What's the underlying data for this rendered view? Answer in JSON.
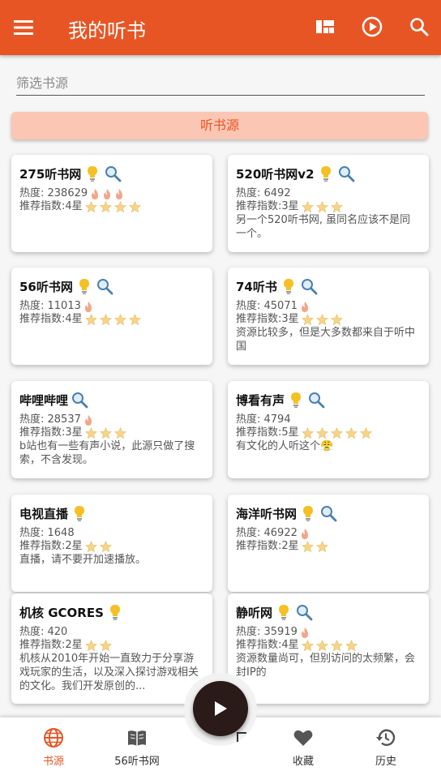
{
  "appbar": {
    "title": "我的听书",
    "icons": [
      "menu-icon",
      "grid-view-icon",
      "play-circle-icon",
      "search-icon"
    ],
    "color": "#e85524"
  },
  "filter": {
    "placeholder": "筛选书源"
  },
  "section_button": {
    "label": "听书源"
  },
  "cards": [
    {
      "name": "275听书网",
      "heat": "热度: 238629",
      "flames": 3,
      "rating": "推荐指数:4星",
      "stars": 4,
      "desc": ""
    },
    {
      "name": "520听书网v2",
      "heat": "热度: 6492",
      "flames": 0,
      "rating": "推荐指数:3星",
      "stars": 3,
      "desc": "另一个520听书网, 虽同名应该不是同一个。"
    },
    {
      "name": "56听书网",
      "heat": "热度: 11013",
      "flames": 1,
      "rating": "推荐指数:4星",
      "stars": 4,
      "desc": ""
    },
    {
      "name": "74听书",
      "heat": "热度: 45071",
      "flames": 1,
      "rating": "推荐指数:3星",
      "stars": 3,
      "desc": "资源比较多，但是大多数都来自于听中国"
    },
    {
      "name": "哔哩哔哩",
      "heat": "热度: 28537",
      "flames": 1,
      "rating": "推荐指数:3星",
      "stars": 3,
      "desc": "b站也有一些有声小说，此源只做了搜索，不含发现。",
      "no_bulb": true
    },
    {
      "name": "博看有声",
      "heat": "热度: 4794",
      "flames": 0,
      "rating": "推荐指数:5星",
      "stars": 5,
      "desc": "有文化的人听这个😤"
    },
    {
      "name": "电视直播",
      "heat": "热度: 1648",
      "flames": 0,
      "rating": "推荐指数:2星",
      "stars": 2,
      "desc": "直播，请不要开加速播放。",
      "no_search": true
    },
    {
      "name": "海洋听书网",
      "heat": "热度: 46922",
      "flames": 1,
      "rating": "推荐指数:2星",
      "stars": 2,
      "desc": ""
    },
    {
      "name": "机核 GCORES",
      "heat": "热度: 420",
      "flames": 0,
      "rating": "推荐指数:2星",
      "stars": 2,
      "desc": "机核从2010年开始一直致力于分享游戏玩家的生活，以及深入探讨游戏相关的文化。我们开发原创的...",
      "no_search": true
    },
    {
      "name": "静听网",
      "heat": "热度: 35919",
      "flames": 1,
      "rating": "推荐指数:4星",
      "stars": 4,
      "desc": "资源数量尚可，但别访问的太频繁，会封IP的"
    }
  ],
  "bottom_nav": [
    {
      "label": "书源",
      "icon": "globe-icon",
      "active": true
    },
    {
      "label": "56听书网",
      "icon": "book-icon",
      "active": false
    },
    {
      "label": "收藏",
      "icon": "heart-icon",
      "active": false
    },
    {
      "label": "历史",
      "icon": "history-icon",
      "active": false
    }
  ],
  "fab": {
    "icon": "play-icon"
  },
  "colors": {
    "accent": "#e85524",
    "section_bg": "#fbc6b4",
    "star": "#f6d48a",
    "flame": "#f3a58a",
    "bulb": "#f5c024",
    "magnifier": "#4a7fb0"
  }
}
